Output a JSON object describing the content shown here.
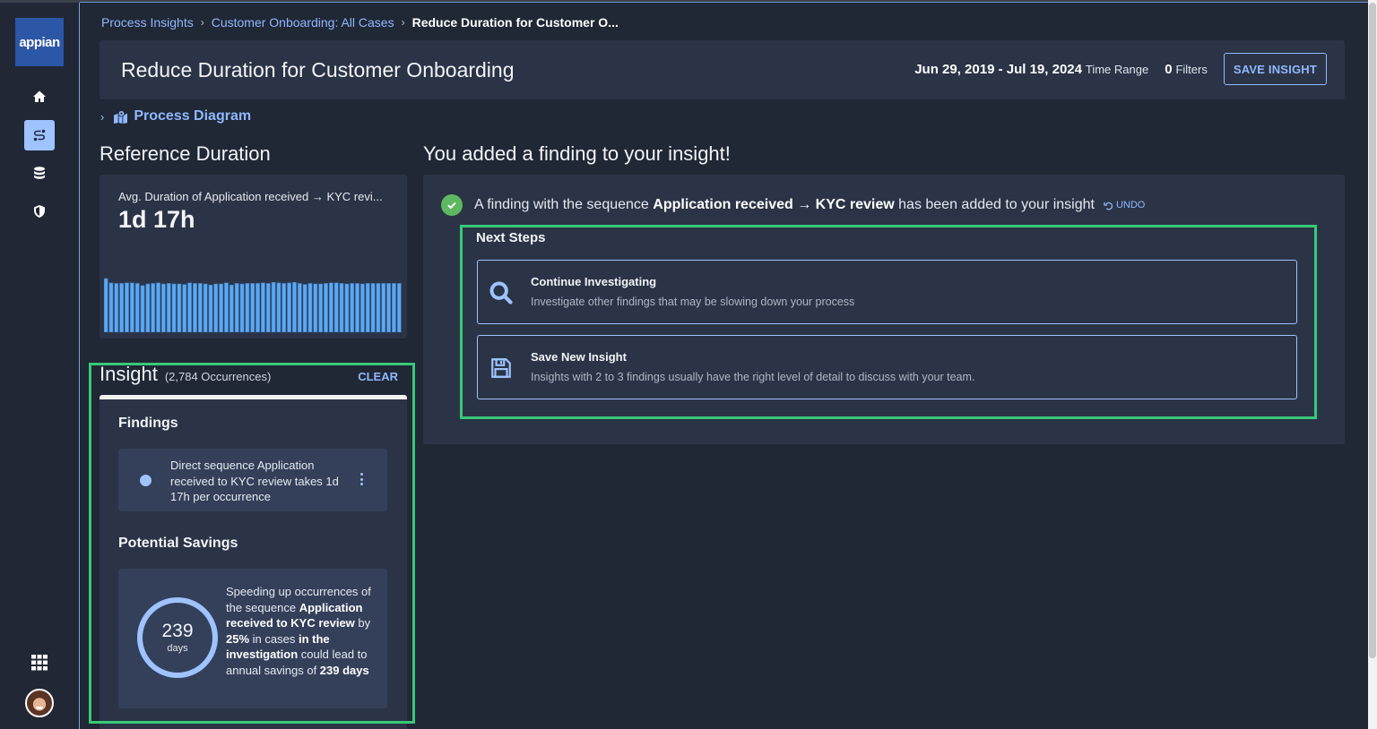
{
  "sidebar": {
    "logo": "appian",
    "items": [
      {
        "name": "home",
        "icon": "home-icon",
        "active": false
      },
      {
        "name": "process-insights",
        "icon": "route-icon",
        "active": true
      },
      {
        "name": "data",
        "icon": "database-icon",
        "active": false
      },
      {
        "name": "security",
        "icon": "shield-icon",
        "active": false
      }
    ],
    "bottom": [
      {
        "name": "apps",
        "icon": "grid-icon"
      },
      {
        "name": "user",
        "icon": "avatar"
      }
    ]
  },
  "breadcrumb": {
    "items": [
      "Process Insights",
      "Customer Onboarding: All Cases"
    ],
    "current": "Reduce Duration for Customer O..."
  },
  "header": {
    "title": "Reduce Duration for Customer Onboarding",
    "date_range": "Jun 29, 2019 - Jul 19, 2024",
    "date_range_label": "Time Range",
    "filters_count": "0",
    "filters_label": "Filters",
    "save_button": "SAVE INSIGHT"
  },
  "process_diagram": {
    "label": "Process Diagram",
    "expanded": false
  },
  "reference_duration": {
    "title": "Reference Duration",
    "label": "Avg. Duration of Application received → KYC revi...",
    "value": "1d 17h"
  },
  "chart_data": {
    "type": "bar",
    "title": "Avg. Duration of Application received → KYC review",
    "xlabel": "",
    "ylabel": "",
    "grid": false,
    "ylim": [
      0,
      1
    ],
    "values": [
      1.0,
      0.92,
      0.91,
      0.91,
      0.92,
      0.92,
      0.91,
      0.87,
      0.9,
      0.91,
      0.92,
      0.9,
      0.91,
      0.9,
      0.9,
      0.89,
      0.92,
      0.91,
      0.91,
      0.9,
      0.88,
      0.9,
      0.9,
      0.92,
      0.88,
      0.91,
      0.9,
      0.91,
      0.91,
      0.91,
      0.92,
      0.91,
      0.93,
      0.92,
      0.91,
      0.92,
      0.93,
      0.91,
      0.89,
      0.91,
      0.9,
      0.9,
      0.91,
      0.92,
      0.92,
      0.91,
      0.9,
      0.91,
      0.91,
      0.9,
      0.91,
      0.91,
      0.91,
      0.91,
      0.91,
      0.91,
      0.91
    ],
    "color": "#5aa9f5"
  },
  "insight": {
    "title": "Insight",
    "occurrences": "(2,784 Occurrences)",
    "clear_label": "CLEAR",
    "findings_title": "Findings",
    "findings": [
      {
        "text": "Direct sequence Application received to KYC review takes 1d 17h per occurrence"
      }
    ],
    "savings_title": "Potential Savings",
    "savings": {
      "value": "239",
      "unit": "days",
      "text_1": "Speeding up occurrences of the sequence ",
      "text_2": "Application received to KYC review",
      "text_3": " by ",
      "text_4": "25%",
      "text_5": " in cases ",
      "text_6": "in the investigation",
      "text_7": " could lead to annual savings of ",
      "text_8": "239 days"
    }
  },
  "confirmation": {
    "title": "You added a finding to your insight!",
    "message_prefix": "A finding with the sequence ",
    "message_bold": "Application received → KYC review",
    "message_suffix": " has been added to your insight",
    "undo_label": "UNDO"
  },
  "next_steps": {
    "title": "Next Steps",
    "items": [
      {
        "icon": "search-icon",
        "title": "Continue Investigating",
        "description": "Investigate other findings that may be slowing down your process"
      },
      {
        "icon": "save-icon",
        "title": "Save New Insight",
        "description": "Insights with 2 to 3 findings usually have the right level of detail to discuss with your team."
      }
    ]
  },
  "colors": {
    "background": "#202735",
    "card": "#2b3446",
    "accent": "#8fb8ff",
    "highlight_box": "#37c977",
    "success": "#5fb85f",
    "logo": "#2c57a6"
  }
}
